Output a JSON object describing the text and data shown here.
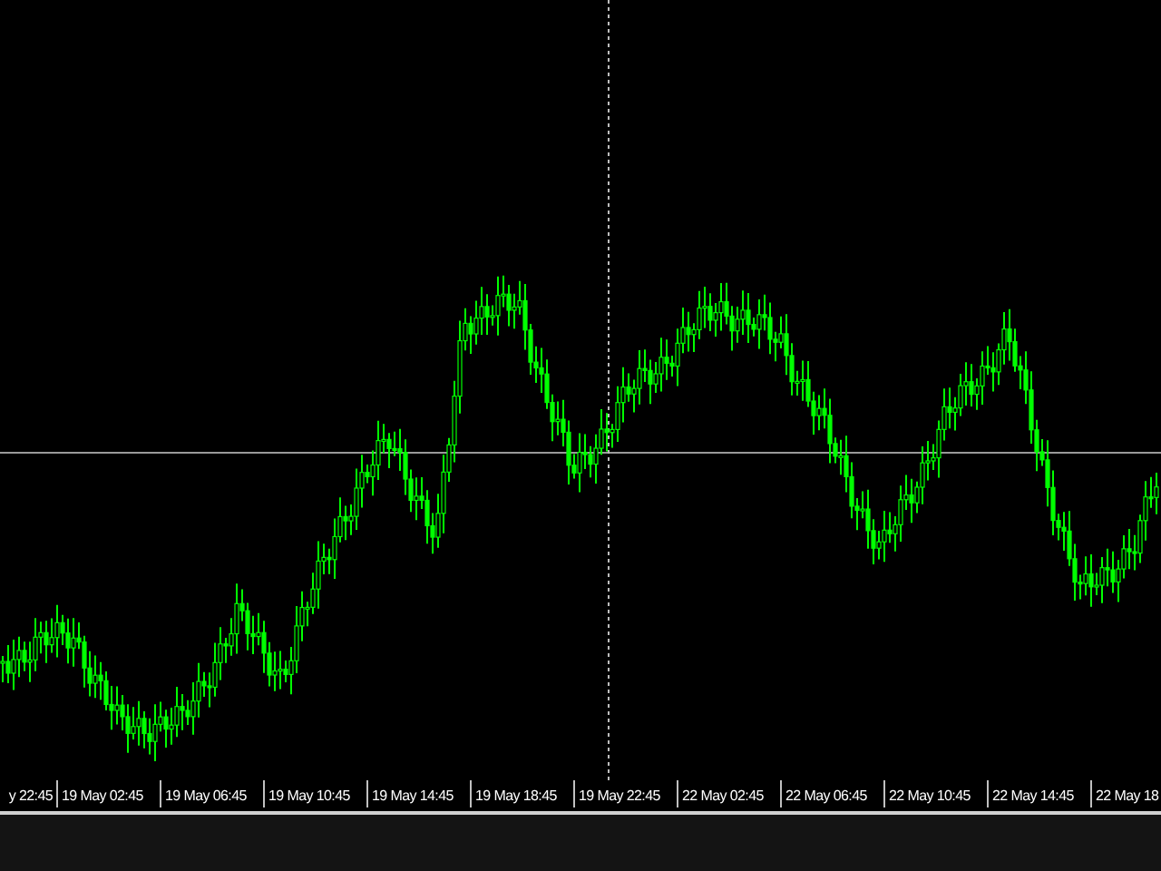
{
  "chart": {
    "x_axis_labels": [
      "y 22:45",
      "19 May 02:45",
      "19 May 06:45",
      "19 May 10:45",
      "19 May 14:45",
      "19 May 18:45",
      "19 May 22:45",
      "22 May 02:45",
      "22 May 06:45",
      "22 May 10:45",
      "22 May 14:45",
      "22 May 18"
    ]
  }
}
